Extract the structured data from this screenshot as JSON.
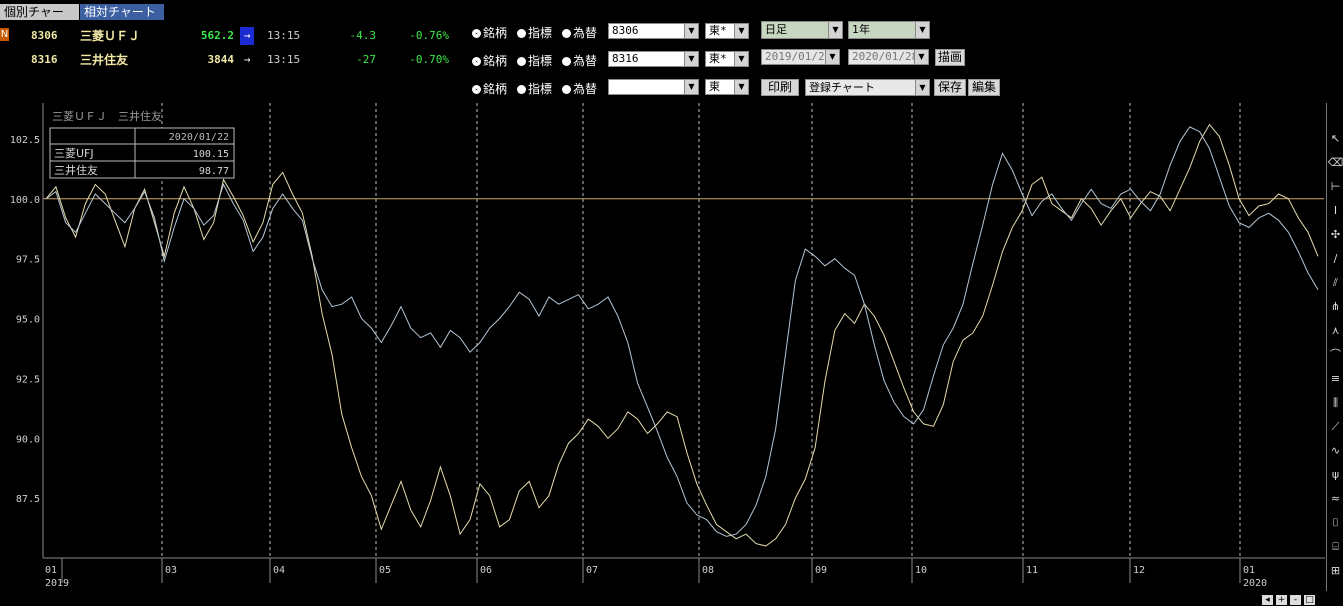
{
  "tabs": [
    {
      "label": "個別チャート"
    },
    {
      "label": "相対チャート"
    }
  ],
  "marker_label": "N",
  "quotes": [
    {
      "code": "8306",
      "name": "三菱ＵＦＪ",
      "price": "562.2",
      "arrow": "→",
      "time": "13:15",
      "change": "-4.3",
      "percent": "-0.76%"
    },
    {
      "code": "8316",
      "name": "三井住友",
      "price": "3844",
      "arrow": "→",
      "time": "13:15",
      "change": "-27",
      "percent": "-0.70%"
    }
  ],
  "selector_rows": [
    {
      "opt1": "銘柄",
      "opt2": "指標",
      "opt3": "為替",
      "code": "8306",
      "market": "東*"
    },
    {
      "opt1": "銘柄",
      "opt2": "指標",
      "opt3": "為替",
      "code": "8316",
      "market": "東*"
    },
    {
      "opt1": "銘柄",
      "opt2": "指標",
      "opt3": "為替",
      "code": "",
      "market": "東"
    }
  ],
  "controls": {
    "period_type": "日足",
    "range": "1年",
    "date_from": "2019/01/28",
    "date_to": "2020/01/28",
    "draw_label": "描画",
    "print_label": "印刷",
    "registered_chart": "登録チャート",
    "save_label": "保存",
    "edit_label": "編集"
  },
  "chart_legend": {
    "series_names": "三菱ＵＦＪ　三井住友",
    "date_header": "2020/01/22",
    "rows": [
      {
        "name": "三菱UFJ",
        "value": "100.15"
      },
      {
        "name": "三井住友",
        "value": "98.77"
      }
    ]
  },
  "chart_data": {
    "type": "line",
    "ylim": [
      85,
      104
    ],
    "yticks": [
      "102.5",
      "100.0",
      "97.5",
      "95.0",
      "92.5",
      "90.0",
      "87.5"
    ],
    "ytick_values": [
      102.5,
      100.0,
      97.5,
      95.0,
      92.5,
      90.0,
      87.5
    ],
    "baseline": 100.0,
    "x_month_labels": [
      "01",
      "03",
      "04",
      "05",
      "06",
      "07",
      "08",
      "09",
      "10",
      "11",
      "12",
      "01"
    ],
    "x_year_labels": [
      "2019",
      "2020"
    ],
    "series": [
      {
        "name": "三菱UFJ",
        "color": "#e6dcae",
        "values": [
          100,
          100.5,
          99.2,
          98.4,
          99.8,
          100.6,
          100.2,
          99.1,
          98.0,
          99.6,
          100.4,
          99.0,
          97.6,
          99.4,
          100.5,
          99.6,
          98.3,
          99.0,
          100.8,
          100.1,
          99.3,
          98.2,
          99.0,
          100.6,
          101.1,
          100.2,
          99.4,
          97.6,
          95.2,
          93.5,
          91.0,
          89.6,
          88.4,
          87.6,
          86.2,
          87.2,
          88.2,
          87.0,
          86.3,
          87.4,
          88.8,
          87.6,
          86.0,
          86.6,
          88.1,
          87.6,
          86.3,
          86.6,
          87.8,
          88.2,
          87.1,
          87.6,
          88.9,
          89.8,
          90.2,
          90.8,
          90.5,
          90.0,
          90.4,
          91.1,
          90.8,
          90.2,
          90.6,
          91.1,
          90.9,
          89.4,
          88.1,
          87.2,
          86.4,
          86.1,
          85.8,
          86.0,
          85.6,
          85.5,
          85.8,
          86.4,
          87.5,
          88.3,
          89.6,
          92.4,
          94.5,
          95.2,
          94.8,
          95.6,
          95.1,
          94.3,
          93.2,
          92.1,
          91.1,
          90.6,
          90.5,
          91.4,
          93.2,
          94.1,
          94.4,
          95.1,
          96.4,
          97.8,
          98.8,
          99.5,
          100.6,
          100.9,
          99.8,
          99.5,
          99.2,
          100.0,
          99.6,
          98.9,
          99.5,
          100.0,
          99.2,
          99.8,
          100.3,
          100.1,
          99.5,
          100.4,
          101.3,
          102.4,
          103.1,
          102.6,
          101.4,
          100.0,
          99.3,
          99.7,
          99.8,
          100.2,
          100.0,
          99.2,
          98.6,
          97.6
        ]
      },
      {
        "name": "三井住友",
        "color": "#b4c6d6",
        "values": [
          100,
          100.3,
          99.0,
          98.6,
          99.4,
          100.2,
          99.8,
          99.4,
          99.0,
          99.6,
          100.3,
          99.2,
          97.4,
          98.8,
          100.0,
          99.6,
          98.9,
          99.3,
          100.6,
          99.8,
          99.1,
          97.8,
          98.4,
          99.6,
          100.2,
          99.6,
          99.1,
          97.5,
          96.2,
          95.5,
          95.6,
          95.9,
          95.0,
          94.6,
          94.0,
          94.7,
          95.5,
          94.6,
          94.2,
          94.4,
          93.8,
          94.5,
          94.2,
          93.6,
          94.0,
          94.6,
          95.0,
          95.5,
          96.1,
          95.8,
          95.1,
          95.9,
          95.6,
          95.8,
          96.0,
          95.4,
          95.6,
          95.9,
          95.1,
          94.0,
          92.3,
          91.3,
          90.3,
          89.2,
          88.4,
          87.3,
          86.8,
          86.6,
          86.1,
          85.9,
          86.0,
          86.4,
          87.2,
          88.4,
          90.4,
          93.5,
          96.6,
          97.9,
          97.6,
          97.2,
          97.5,
          97.1,
          96.8,
          95.6,
          93.9,
          92.4,
          91.5,
          90.9,
          90.6,
          91.2,
          92.6,
          93.9,
          94.6,
          95.6,
          97.3,
          98.9,
          100.6,
          101.9,
          101.2,
          100.2,
          99.3,
          99.9,
          100.2,
          99.6,
          99.1,
          99.8,
          100.4,
          99.8,
          99.6,
          100.2,
          100.4,
          99.9,
          99.5,
          100.2,
          101.4,
          102.4,
          103.0,
          102.8,
          102.1,
          100.9,
          99.7,
          99.0,
          98.8,
          99.2,
          99.4,
          99.1,
          98.6,
          97.8,
          96.9,
          96.2
        ]
      }
    ]
  },
  "toolbar_icons": [
    "cursor-icon",
    "eraser-icon",
    "horizontal-line-icon",
    "vertical-line-icon",
    "crosshair-icon",
    "trendline-icon",
    "parallel-line-icon",
    "fibonacci-icon",
    "fan-icon",
    "arc-icon",
    "channel-icon",
    "bar-icon",
    "diagonal-icon",
    "zigzag-icon",
    "pitchfork-icon",
    "wave-icon",
    "box-icon",
    "box2-icon",
    "grid-icon",
    "magnet-icon"
  ],
  "statusbar": {
    "left_btn": "◂",
    "right_btn": "▸",
    "plus": "+",
    "minus": "-",
    "full": "□"
  }
}
